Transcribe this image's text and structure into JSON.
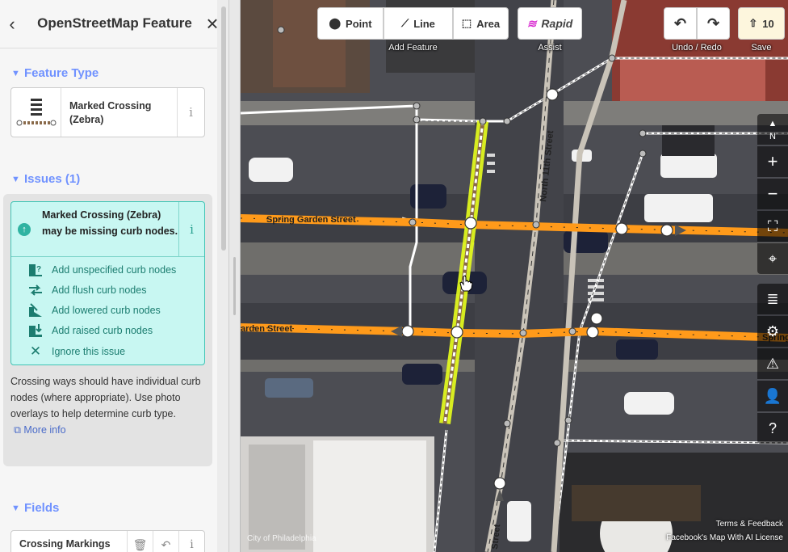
{
  "sidebar": {
    "title": "OpenStreetMap Feature",
    "feature_type_heading": "Feature Type",
    "feature_type_name": "Marked Crossing (Zebra)",
    "issues_heading": "Issues (1)",
    "issue_message": "Marked Crossing (Zebra) may be missing curb nodes.",
    "fixes": [
      {
        "label": "Add unspecified curb nodes",
        "icon": "curb-unspecified-icon"
      },
      {
        "label": "Add flush curb nodes",
        "icon": "curb-flush-icon"
      },
      {
        "label": "Add lowered curb nodes",
        "icon": "curb-lowered-icon"
      },
      {
        "label": "Add raised curb nodes",
        "icon": "curb-raised-icon"
      },
      {
        "label": "Ignore this issue",
        "icon": "close-icon"
      }
    ],
    "issue_description": "Crossing ways should have individual curb nodes (where appropriate). Use photo overlays to help determine curb type.",
    "more_info": "More info",
    "fields_heading": "Fields",
    "field_label": "Crossing Markings"
  },
  "toolbar": {
    "point": "Point",
    "line": "Line",
    "area": "Area",
    "add_feature": "Add Feature",
    "rapid": "Rapid",
    "assist": "Assist",
    "undo_redo": "Undo / Redo",
    "save_count": "10",
    "save": "Save"
  },
  "map": {
    "street_labels": [
      "Spring Garden Street",
      "Garden Street",
      "North 11th Street",
      "Spring",
      "Street",
      "City of Philadelphia"
    ],
    "compass_letter": "N",
    "attribution_terms": "Terms & Feedback",
    "attribution_license": "Facebook's Map With AI License"
  },
  "colors": {
    "accent": "#7092ff",
    "issue_bg": "#c8f7f2",
    "issue_border": "#41c4b5",
    "road_orange": "#ff9a1a",
    "selection_yellow": "#e8ff1c"
  }
}
